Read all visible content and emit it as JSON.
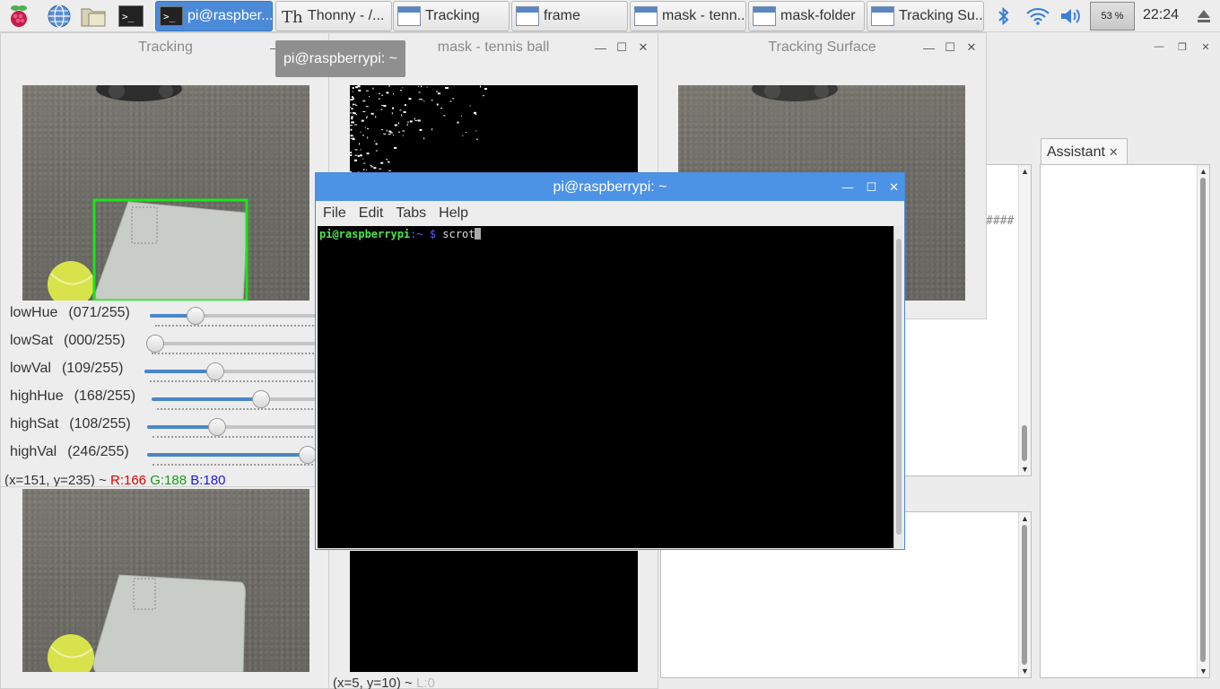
{
  "panel": {
    "launchers": [
      {
        "icon": "raspberry-menu-icon"
      },
      {
        "icon": "web-browser-icon"
      },
      {
        "icon": "file-manager-icon"
      },
      {
        "icon": "terminal-icon"
      }
    ],
    "tasks": [
      {
        "label": "pi@raspber...",
        "icon": "terminal-icon",
        "active": true
      },
      {
        "label": "Thonny  -  /...",
        "icon": "thonny-icon",
        "active": false
      },
      {
        "label": "Tracking",
        "icon": "window-icon",
        "active": false
      },
      {
        "label": "frame",
        "icon": "window-icon",
        "active": false
      },
      {
        "label": "mask - tenn...",
        "icon": "window-icon",
        "active": false
      },
      {
        "label": "mask-folder",
        "icon": "window-icon",
        "active": false
      },
      {
        "label": "Tracking Su...",
        "icon": "window-icon",
        "active": false
      }
    ],
    "battery": "53 %",
    "clock": "22:24"
  },
  "tracking_window": {
    "title": "Tracking",
    "sliders": [
      {
        "name": "lowHue",
        "value": "(071/255)",
        "level": 0.278
      },
      {
        "name": "lowSat",
        "value": "(000/255)",
        "level": 0.0
      },
      {
        "name": "lowVal",
        "value": "(109/255)",
        "level": 0.427
      },
      {
        "name": "highHue",
        "value": "(168/255)",
        "level": 0.659
      },
      {
        "name": "highSat",
        "value": "(108/255)",
        "level": 0.424
      },
      {
        "name": "highVal",
        "value": "(246/255)",
        "level": 0.965
      }
    ],
    "status": {
      "coords": "(x=151, y=235) ~ ",
      "r": "R:166",
      "g": "G:188",
      "b": "B:180"
    }
  },
  "mask_window": {
    "title": "mask - tennis ball",
    "status": {
      "coords": "(x=5, y=10) ~ ",
      "l": "L:0"
    }
  },
  "surface_window": {
    "title": "Tracking Surface",
    "hash_text": "####"
  },
  "tooltip": "pi@raspberrypi: ~",
  "terminal": {
    "title": "pi@raspberrypi: ~",
    "menu": [
      "File",
      "Edit",
      "Tabs",
      "Help"
    ],
    "prompt_user": "pi@raspberrypi",
    "prompt_path": ":~ ",
    "prompt_symbol": "$ ",
    "command": "scrot"
  },
  "assistant": {
    "tab_label": "Assistant",
    "close": "✕"
  },
  "colors": {
    "accent": "#4c93e6",
    "bbox_green": "#19e619",
    "prompt_green": "#4ee64e",
    "prompt_blue": "#5c5cff",
    "status_red": "#e00000",
    "status_green": "#1a9c1a",
    "status_blue": "#1a1ae0"
  }
}
